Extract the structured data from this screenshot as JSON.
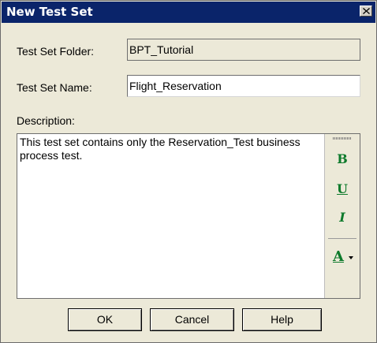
{
  "window": {
    "title": "New Test Set"
  },
  "form": {
    "folder_label": "Test Set Folder:",
    "folder_value": "BPT_Tutorial",
    "name_label": "Test Set Name:",
    "name_value": "Flight_Reservation",
    "description_label": "Description:",
    "description_value": "This test set contains only the Reservation_Test business process test."
  },
  "toolbar": {
    "bold_label": "B",
    "underline_label": "U",
    "italic_label": "I",
    "font_color_label": "A",
    "icons": [
      "bold-icon",
      "underline-icon",
      "italic-icon",
      "font-color-icon",
      "chevron-down-icon",
      "close-icon"
    ]
  },
  "buttons": {
    "ok": "OK",
    "cancel": "Cancel",
    "help": "Help"
  },
  "colors": {
    "title_bar": "#0a246a",
    "dialog_bg": "#ece9d8",
    "format_icons": "#0d7a2b"
  }
}
